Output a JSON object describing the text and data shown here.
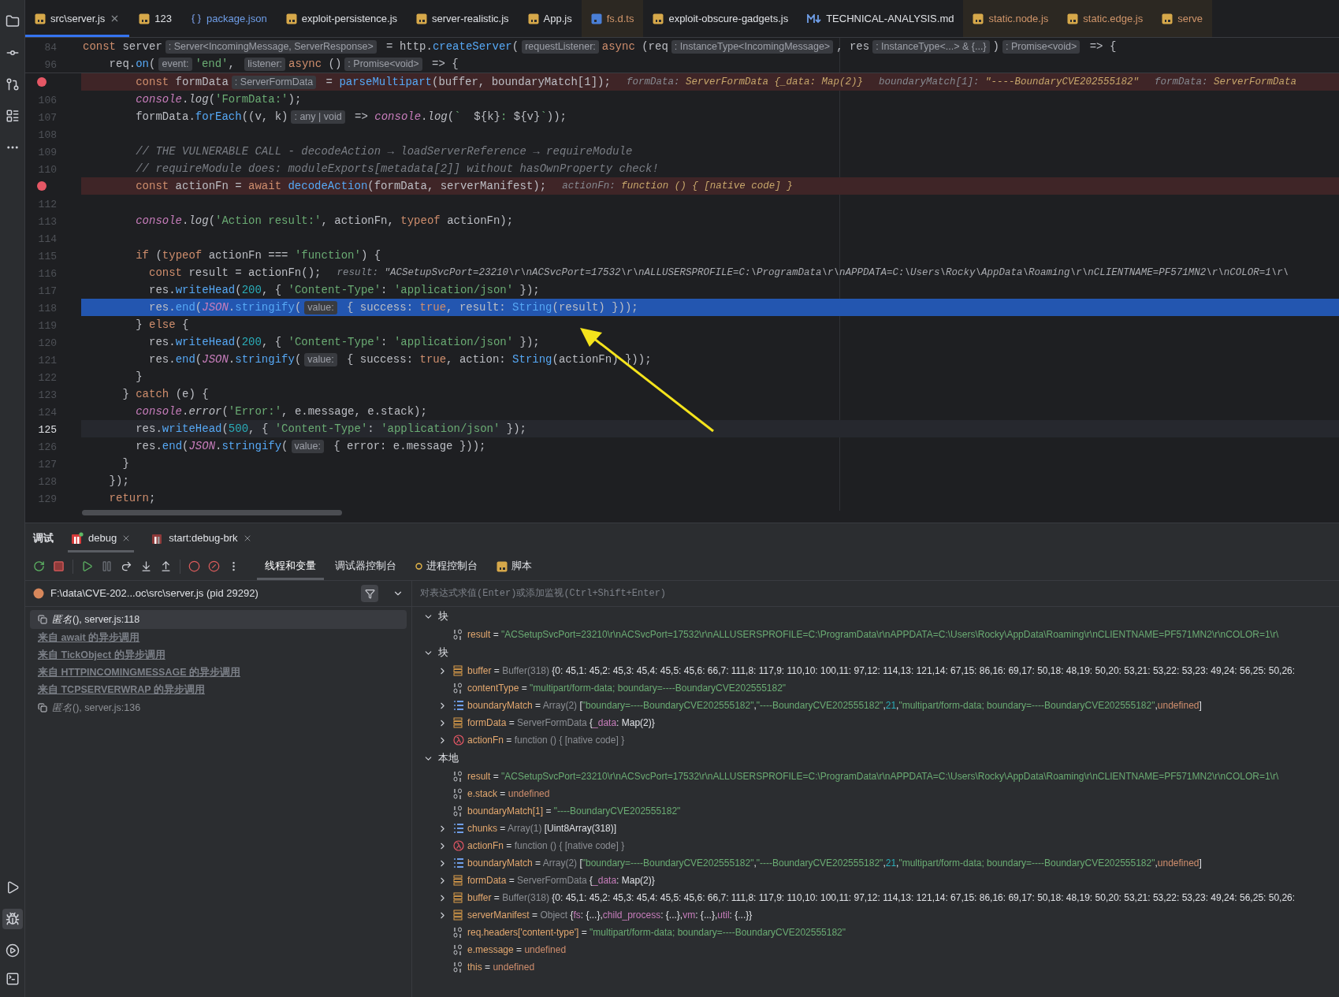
{
  "editor_tabs": [
    {
      "label": "src\\server.js",
      "kind": "js",
      "selected": true,
      "closable": true,
      "color": "#dfe1e5",
      "highlighted": false
    },
    {
      "label": "123",
      "kind": "js",
      "selected": false,
      "closable": false,
      "color": "#dfe1e5",
      "highlighted": false
    },
    {
      "label": "package.json",
      "kind": "json",
      "selected": false,
      "closable": false,
      "color": "#6f9ee8",
      "highlighted": false
    },
    {
      "label": "exploit-persistence.js",
      "kind": "js",
      "selected": false,
      "closable": false,
      "color": "#dfe1e5",
      "highlighted": false
    },
    {
      "label": "server-realistic.js",
      "kind": "js",
      "selected": false,
      "closable": false,
      "color": "#dfe1e5",
      "highlighted": false
    },
    {
      "label": "App.js",
      "kind": "js",
      "selected": false,
      "closable": false,
      "color": "#dfe1e5",
      "highlighted": false
    },
    {
      "label": "fs.d.ts",
      "kind": "ts",
      "selected": false,
      "closable": false,
      "color": "#d0956a",
      "highlighted": true
    },
    {
      "label": "exploit-obscure-gadgets.js",
      "kind": "js",
      "selected": false,
      "closable": false,
      "color": "#dfe1e5",
      "highlighted": false
    },
    {
      "label": "TECHNICAL-ANALYSIS.md",
      "kind": "md",
      "selected": false,
      "closable": false,
      "color": "#dfe1e5",
      "highlighted": false
    },
    {
      "label": "static.node.js",
      "kind": "js",
      "selected": false,
      "closable": false,
      "color": "#d0956a",
      "highlighted": true
    },
    {
      "label": "static.edge.js",
      "kind": "js",
      "selected": false,
      "closable": false,
      "color": "#d0956a",
      "highlighted": true
    },
    {
      "label": "serve",
      "kind": "js",
      "selected": false,
      "closable": false,
      "color": "#d0956a",
      "highlighted": true
    }
  ],
  "sticky_lines": [
    {
      "number": "84",
      "segments": [
        {
          "kind": "k",
          "text": "const"
        },
        {
          "kind": "p",
          "text": " server"
        },
        {
          "kind": "hint",
          "text": ": Server<IncomingMessage, ServerResponse>"
        },
        {
          "kind": "p",
          "text": " = http."
        },
        {
          "kind": "f",
          "text": "createServer"
        },
        {
          "kind": "p",
          "text": "("
        },
        {
          "kind": "hint",
          "text": "requestListener:"
        },
        {
          "kind": "k",
          "text": "async"
        },
        {
          "kind": "p",
          "text": " (req"
        },
        {
          "kind": "hint",
          "text": ": InstanceType<IncomingMessage>"
        },
        {
          "kind": "p",
          "text": ", res"
        },
        {
          "kind": "hint",
          "text": ": InstanceType<...> & {...}"
        },
        {
          "kind": "p",
          "text": ")"
        },
        {
          "kind": "hint",
          "text": ": Promise<void>"
        },
        {
          "kind": "p",
          "text": " => {"
        }
      ]
    },
    {
      "number": "96",
      "segments": [
        {
          "kind": "p",
          "text": "    req."
        },
        {
          "kind": "f",
          "text": "on"
        },
        {
          "kind": "p",
          "text": "("
        },
        {
          "kind": "hint",
          "text": "event:"
        },
        {
          "kind": "s",
          "text": "'end'"
        },
        {
          "kind": "p",
          "text": ", "
        },
        {
          "kind": "hint",
          "text": "listener:"
        },
        {
          "kind": "k",
          "text": "async"
        },
        {
          "kind": "p",
          "text": " ()"
        },
        {
          "kind": "hint",
          "text": ": Promise<void>"
        },
        {
          "kind": "p",
          "text": " => {"
        }
      ]
    }
  ],
  "code_lines": [
    {
      "breakpoint": true,
      "execution_point": false,
      "caret_line": false,
      "segments": [
        {
          "kind": "k",
          "text": "        const"
        },
        {
          "kind": "p",
          "text": " formData"
        },
        {
          "kind": "hint",
          "text": ": ServerFormData"
        },
        {
          "kind": "p",
          "text": " = "
        },
        {
          "kind": "f",
          "text": "parseMultipart"
        },
        {
          "kind": "p",
          "text": "(buffer, boundaryMatch[1]);"
        },
        {
          "kind": "vname",
          "text": "formData: "
        },
        {
          "kind": "val",
          "text": "ServerFormData {_data: Map(2)}"
        },
        {
          "kind": "vname",
          "text": "boundaryMatch[1]: "
        },
        {
          "kind": "val",
          "text": "\"----BoundaryCVE202555182\""
        },
        {
          "kind": "vname",
          "text": "formData: "
        },
        {
          "kind": "val",
          "text": "ServerFormData"
        }
      ]
    },
    {
      "number": "106",
      "breakpoint": false,
      "execution_point": false,
      "caret_line": false,
      "segments": [
        {
          "kind": "ip",
          "text": "        console"
        },
        {
          "kind": "p",
          "text": "."
        },
        {
          "kind": "it",
          "text": "log"
        },
        {
          "kind": "p",
          "text": "("
        },
        {
          "kind": "s",
          "text": "'FormData:'"
        },
        {
          "kind": "p",
          "text": ");"
        }
      ]
    },
    {
      "number": "107",
      "breakpoint": false,
      "execution_point": false,
      "caret_line": false,
      "segments": [
        {
          "kind": "p",
          "text": "        formData."
        },
        {
          "kind": "f",
          "text": "forEach"
        },
        {
          "kind": "p",
          "text": "((v, k)"
        },
        {
          "kind": "hint",
          "text": ": any | void"
        },
        {
          "kind": "p",
          "text": " => "
        },
        {
          "kind": "ip",
          "text": "console"
        },
        {
          "kind": "p",
          "text": "."
        },
        {
          "kind": "it",
          "text": "log"
        },
        {
          "kind": "p",
          "text": "("
        },
        {
          "kind": "s",
          "text": "`  "
        },
        {
          "kind": "p",
          "text": "${k}"
        },
        {
          "kind": "s",
          "text": ": "
        },
        {
          "kind": "p",
          "text": "${v}"
        },
        {
          "kind": "s",
          "text": "`"
        },
        {
          "kind": "p",
          "text": "));"
        }
      ]
    },
    {
      "number": "108",
      "breakpoint": false,
      "execution_point": false,
      "caret_line": false
    },
    {
      "number": "109",
      "breakpoint": false,
      "execution_point": false,
      "caret_line": false,
      "segments": [
        {
          "kind": "c",
          "text": "        // THE VULNERABLE CALL - decodeAction → loadServerReference → requireModule"
        }
      ]
    },
    {
      "number": "110",
      "breakpoint": false,
      "execution_point": false,
      "caret_line": false,
      "segments": [
        {
          "kind": "c",
          "text": "        // requireModule does: moduleExports[metadata[2]] without hasOwnProperty check!"
        }
      ]
    },
    {
      "breakpoint": true,
      "execution_point": false,
      "caret_line": false,
      "segments": [
        {
          "kind": "k",
          "text": "        const"
        },
        {
          "kind": "p",
          "text": " actionFn = "
        },
        {
          "kind": "k",
          "text": "await"
        },
        {
          "kind": "f",
          "text": " decodeAction"
        },
        {
          "kind": "p",
          "text": "(formData, serverManifest);"
        },
        {
          "kind": "vname",
          "text": "actionFn: "
        },
        {
          "kind": "val",
          "text": "function () { [native code] }"
        }
      ]
    },
    {
      "number": "112",
      "breakpoint": false,
      "execution_point": false,
      "caret_line": false
    },
    {
      "number": "113",
      "breakpoint": false,
      "execution_point": false,
      "caret_line": false,
      "segments": [
        {
          "kind": "ip",
          "text": "        console"
        },
        {
          "kind": "p",
          "text": "."
        },
        {
          "kind": "it",
          "text": "log"
        },
        {
          "kind": "p",
          "text": "("
        },
        {
          "kind": "s",
          "text": "'Action result:'"
        },
        {
          "kind": "p",
          "text": ", actionFn, "
        },
        {
          "kind": "k",
          "text": "typeof"
        },
        {
          "kind": "p",
          "text": " actionFn);"
        }
      ]
    },
    {
      "number": "114",
      "breakpoint": false,
      "execution_point": false,
      "caret_line": false
    },
    {
      "number": "115",
      "breakpoint": false,
      "execution_point": false,
      "caret_line": false,
      "segments": [
        {
          "kind": "k",
          "text": "        if"
        },
        {
          "kind": "p",
          "text": " ("
        },
        {
          "kind": "k",
          "text": "typeof"
        },
        {
          "kind": "p",
          "text": " actionFn === "
        },
        {
          "kind": "s",
          "text": "'function'"
        },
        {
          "kind": "p",
          "text": ") {"
        }
      ]
    },
    {
      "number": "116",
      "breakpoint": false,
      "execution_point": false,
      "caret_line": false,
      "segments": [
        {
          "kind": "k",
          "text": "          const"
        },
        {
          "kind": "p",
          "text": " result = actionFn();"
        },
        {
          "kind": "vname",
          "text": "result: "
        },
        {
          "kind": "val2",
          "text": "\"ACSetupSvcPort=23210\\r\\nACSvcPort=17532\\r\\nALLUSERSPROFILE=C:\\ProgramData\\r\\nAPPDATA=C:\\Users\\Rocky\\AppData\\Roaming\\r\\nCLIENTNAME=PF571MN2\\r\\nCOLOR=1\\r\\"
        }
      ]
    },
    {
      "number": "117",
      "breakpoint": false,
      "execution_point": false,
      "caret_line": false,
      "segments": [
        {
          "kind": "p",
          "text": "          res."
        },
        {
          "kind": "f",
          "text": "writeHead"
        },
        {
          "kind": "p",
          "text": "("
        },
        {
          "kind": "n",
          "text": "200"
        },
        {
          "kind": "p",
          "text": ", { "
        },
        {
          "kind": "s",
          "text": "'Content-Type'"
        },
        {
          "kind": "p",
          "text": ": "
        },
        {
          "kind": "s",
          "text": "'application/json'"
        },
        {
          "kind": "p",
          "text": " });"
        }
      ]
    },
    {
      "number": "118",
      "breakpoint": false,
      "execution_point": true,
      "caret_line": false,
      "segments": [
        {
          "kind": "p",
          "text": "          res."
        },
        {
          "kind": "f",
          "text": "end"
        },
        {
          "kind": "p",
          "text": "("
        },
        {
          "kind": "ip",
          "text": "JSON"
        },
        {
          "kind": "p",
          "text": "."
        },
        {
          "kind": "f",
          "text": "stringify"
        },
        {
          "kind": "p",
          "text": "("
        },
        {
          "kind": "hint",
          "text": "value:"
        },
        {
          "kind": "p",
          "text": " { success: "
        },
        {
          "kind": "k",
          "text": "true"
        },
        {
          "kind": "p",
          "text": ", result: "
        },
        {
          "kind": "f",
          "text": "String"
        },
        {
          "kind": "p",
          "text": "(result) }));"
        }
      ]
    },
    {
      "number": "119",
      "breakpoint": false,
      "execution_point": false,
      "caret_line": false,
      "segments": [
        {
          "kind": "p",
          "text": "        } "
        },
        {
          "kind": "k",
          "text": "else"
        },
        {
          "kind": "p",
          "text": " {"
        }
      ]
    },
    {
      "number": "120",
      "breakpoint": false,
      "execution_point": false,
      "caret_line": false,
      "segments": [
        {
          "kind": "p",
          "text": "          res."
        },
        {
          "kind": "f",
          "text": "writeHead"
        },
        {
          "kind": "p",
          "text": "("
        },
        {
          "kind": "n",
          "text": "200"
        },
        {
          "kind": "p",
          "text": ", { "
        },
        {
          "kind": "s",
          "text": "'Content-Type'"
        },
        {
          "kind": "p",
          "text": ": "
        },
        {
          "kind": "s",
          "text": "'application/json'"
        },
        {
          "kind": "p",
          "text": " });"
        }
      ]
    },
    {
      "number": "121",
      "breakpoint": false,
      "execution_point": false,
      "caret_line": false,
      "segments": [
        {
          "kind": "p",
          "text": "          res."
        },
        {
          "kind": "f",
          "text": "end"
        },
        {
          "kind": "p",
          "text": "("
        },
        {
          "kind": "ip",
          "text": "JSON"
        },
        {
          "kind": "p",
          "text": "."
        },
        {
          "kind": "f",
          "text": "stringify"
        },
        {
          "kind": "p",
          "text": "("
        },
        {
          "kind": "hint",
          "text": "value:"
        },
        {
          "kind": "p",
          "text": " { success: "
        },
        {
          "kind": "k",
          "text": "true"
        },
        {
          "kind": "p",
          "text": ", action: "
        },
        {
          "kind": "f",
          "text": "String"
        },
        {
          "kind": "p",
          "text": "(actionFn) }));"
        }
      ]
    },
    {
      "number": "122",
      "breakpoint": false,
      "execution_point": false,
      "caret_line": false,
      "segments": [
        {
          "kind": "p",
          "text": "        }"
        }
      ]
    },
    {
      "number": "123",
      "breakpoint": false,
      "execution_point": false,
      "caret_line": false,
      "segments": [
        {
          "kind": "p",
          "text": "      } "
        },
        {
          "kind": "k",
          "text": "catch"
        },
        {
          "kind": "p",
          "text": " (e) {"
        }
      ]
    },
    {
      "number": "124",
      "breakpoint": false,
      "execution_point": false,
      "caret_line": false,
      "segments": [
        {
          "kind": "ip",
          "text": "        console"
        },
        {
          "kind": "p",
          "text": "."
        },
        {
          "kind": "it",
          "text": "error"
        },
        {
          "kind": "p",
          "text": "("
        },
        {
          "kind": "s",
          "text": "'Error:'"
        },
        {
          "kind": "p",
          "text": ", e.message, e.stack);"
        }
      ]
    },
    {
      "number": "125",
      "breakpoint": false,
      "execution_point": false,
      "caret_line": true,
      "segments": [
        {
          "kind": "p",
          "text": "        res."
        },
        {
          "kind": "f",
          "text": "writeHead"
        },
        {
          "kind": "p",
          "text": "("
        },
        {
          "kind": "n",
          "text": "500"
        },
        {
          "kind": "p",
          "text": ", { "
        },
        {
          "kind": "s",
          "text": "'Content-Type'"
        },
        {
          "kind": "p",
          "text": ": "
        },
        {
          "kind": "s",
          "text": "'application/json'"
        },
        {
          "kind": "p",
          "text": " });"
        }
      ]
    },
    {
      "number": "126",
      "breakpoint": false,
      "execution_point": false,
      "caret_line": false,
      "segments": [
        {
          "kind": "p",
          "text": "        res."
        },
        {
          "kind": "f",
          "text": "end"
        },
        {
          "kind": "p",
          "text": "("
        },
        {
          "kind": "ip",
          "text": "JSON"
        },
        {
          "kind": "p",
          "text": "."
        },
        {
          "kind": "f",
          "text": "stringify"
        },
        {
          "kind": "p",
          "text": "("
        },
        {
          "kind": "hint",
          "text": "value:"
        },
        {
          "kind": "p",
          "text": " { error: e.message }));"
        }
      ]
    },
    {
      "number": "127",
      "breakpoint": false,
      "execution_point": false,
      "caret_line": false,
      "segments": [
        {
          "kind": "p",
          "text": "      }"
        }
      ]
    },
    {
      "number": "128",
      "breakpoint": false,
      "execution_point": false,
      "caret_line": false,
      "segments": [
        {
          "kind": "p",
          "text": "    });"
        }
      ]
    },
    {
      "number": "129",
      "breakpoint": false,
      "execution_point": false,
      "caret_line": false,
      "segments": [
        {
          "kind": "k",
          "text": "    return"
        },
        {
          "kind": "p",
          "text": ";"
        }
      ]
    }
  ],
  "debug_panel": {
    "title": "调试",
    "run_tabs": [
      {
        "label": "debug",
        "selected": true,
        "running": true
      },
      {
        "label": "start:debug-brk",
        "selected": false,
        "running": false
      }
    ],
    "view_tabs": [
      {
        "label": "线程和变量",
        "selected": true,
        "kind": "plain"
      },
      {
        "label": "调试器控制台",
        "selected": false,
        "kind": "plain"
      },
      {
        "label": "进程控制台",
        "selected": false,
        "kind": "process"
      },
      {
        "label": "脚本",
        "selected": false,
        "kind": "js"
      }
    ],
    "process": {
      "label": "F:\\data\\CVE-202...oc\\src\\server.js (pid 29292)"
    },
    "frames": [
      {
        "kind": "frame",
        "label": "*匿名*(), server.js:118",
        "selected": true
      },
      {
        "kind": "async",
        "label": "来自 await 的异步调用",
        "selected": false
      },
      {
        "kind": "async",
        "label": "来自 TickObject 的异步调用",
        "selected": false
      },
      {
        "kind": "async",
        "label": "来自 HTTPINCOMINGMESSAGE 的异步调用",
        "selected": false
      },
      {
        "kind": "async",
        "label": "来自 TCPSERVERWRAP 的异步调用",
        "selected": false
      },
      {
        "kind": "frame",
        "label": "*匿名*(), server.js:136",
        "selected": false
      }
    ],
    "watch": {
      "placeholder": "对表达式求值(Enter)或添加监视(Ctrl+Shift+Enter)"
    },
    "scopes": [
      {
        "label": "块",
        "expanded": true,
        "variables": [
          {
            "name": "result",
            "kind": "primitive",
            "expandable": false,
            "value": [
              {
                "kind": "plain",
                "text": " = "
              },
              {
                "kind": "str",
                "text": "\"ACSetupSvcPort=23210\\r\\nACSvcPort=17532\\r\\nALLUSERSPROFILE=C:\\ProgramData\\r\\nAPPDATA=C:\\Users\\Rocky\\AppData\\Roaming\\r\\nCLIENTNAME=PF571MN2\\r\\nCOLOR=1\\r\\"
              }
            ]
          }
        ]
      },
      {
        "label": "块",
        "expanded": true,
        "variables": [
          {
            "name": "buffer",
            "kind": "object",
            "expandable": true,
            "value": [
              {
                "kind": "plain",
                "text": " = "
              },
              {
                "kind": "type",
                "text": "Buffer(318)"
              },
              {
                "kind": "plain",
                "text": " {0: 45,1: 45,2: 45,3: 45,4: 45,5: 45,6: 66,7: 111,8: 117,9: 110,10: 100,11: 97,12: 114,13: 121,14: 67,15: 86,16: 69,17: 50,18: 48,19: 50,20: 53,21: 53,22: 53,23: 49,24: 56,25: 50,26:"
              }
            ]
          },
          {
            "name": "contentType",
            "kind": "primitive",
            "expandable": false,
            "value": [
              {
                "kind": "plain",
                "text": " = "
              },
              {
                "kind": "str",
                "text": "\"multipart/form-data; boundary=----BoundaryCVE202555182\""
              }
            ]
          },
          {
            "name": "boundaryMatch",
            "kind": "array",
            "expandable": true,
            "value": [
              {
                "kind": "plain",
                "text": " = "
              },
              {
                "kind": "type",
                "text": "Array(2)"
              },
              {
                "kind": "plain",
                "text": " ["
              },
              {
                "kind": "str",
                "text": "\"boundary=----BoundaryCVE202555182\""
              },
              {
                "kind": "plain",
                "text": ","
              },
              {
                "kind": "str",
                "text": "\"----BoundaryCVE202555182\""
              },
              {
                "kind": "plain",
                "text": ","
              },
              {
                "kind": "num",
                "text": "21"
              },
              {
                "kind": "plain",
                "text": ","
              },
              {
                "kind": "str",
                "text": "\"multipart/form-data; boundary=----BoundaryCVE202555182\""
              },
              {
                "kind": "plain",
                "text": ","
              },
              {
                "kind": "undef",
                "text": "undefined"
              },
              {
                "kind": "plain",
                "text": "]"
              }
            ]
          },
          {
            "name": "formData",
            "kind": "object",
            "expandable": true,
            "value": [
              {
                "kind": "plain",
                "text": " = "
              },
              {
                "kind": "type",
                "text": "ServerFormData"
              },
              {
                "kind": "plain",
                "text": " {"
              },
              {
                "kind": "key",
                "text": "_data"
              },
              {
                "kind": "plain",
                "text": ": Map(2)}"
              }
            ]
          },
          {
            "name": "actionFn",
            "kind": "function",
            "expandable": true,
            "value": [
              {
                "kind": "plain",
                "text": " = "
              },
              {
                "kind": "type",
                "text": "function () { [native code] }"
              }
            ]
          }
        ]
      },
      {
        "label": "本地",
        "expanded": true,
        "variables": [
          {
            "name": "result",
            "kind": "primitive",
            "expandable": false,
            "value": [
              {
                "kind": "plain",
                "text": " = "
              },
              {
                "kind": "str",
                "text": "\"ACSetupSvcPort=23210\\r\\nACSvcPort=17532\\r\\nALLUSERSPROFILE=C:\\ProgramData\\r\\nAPPDATA=C:\\Users\\Rocky\\AppData\\Roaming\\r\\nCLIENTNAME=PF571MN2\\r\\nCOLOR=1\\r\\"
              }
            ]
          },
          {
            "name": "e.stack",
            "kind": "primitive",
            "expandable": false,
            "value": [
              {
                "kind": "plain",
                "text": " = "
              },
              {
                "kind": "undef",
                "text": "undefined"
              }
            ]
          },
          {
            "name": "boundaryMatch[1]",
            "kind": "primitive",
            "expandable": false,
            "value": [
              {
                "kind": "plain",
                "text": " = "
              },
              {
                "kind": "str",
                "text": "\"----BoundaryCVE202555182\""
              }
            ]
          },
          {
            "name": "chunks",
            "kind": "array",
            "expandable": true,
            "value": [
              {
                "kind": "plain",
                "text": " = "
              },
              {
                "kind": "type",
                "text": "Array(1)"
              },
              {
                "kind": "plain",
                "text": " [Uint8Array(318)]"
              }
            ]
          },
          {
            "name": "actionFn",
            "kind": "function",
            "expandable": true,
            "value": [
              {
                "kind": "plain",
                "text": " = "
              },
              {
                "kind": "type",
                "text": "function () { [native code] }"
              }
            ]
          },
          {
            "name": "boundaryMatch",
            "kind": "array",
            "expandable": true,
            "value": [
              {
                "kind": "plain",
                "text": " = "
              },
              {
                "kind": "type",
                "text": "Array(2)"
              },
              {
                "kind": "plain",
                "text": " ["
              },
              {
                "kind": "str",
                "text": "\"boundary=----BoundaryCVE202555182\""
              },
              {
                "kind": "plain",
                "text": ","
              },
              {
                "kind": "str",
                "text": "\"----BoundaryCVE202555182\""
              },
              {
                "kind": "plain",
                "text": ","
              },
              {
                "kind": "num",
                "text": "21"
              },
              {
                "kind": "plain",
                "text": ","
              },
              {
                "kind": "str",
                "text": "\"multipart/form-data; boundary=----BoundaryCVE202555182\""
              },
              {
                "kind": "plain",
                "text": ","
              },
              {
                "kind": "undef",
                "text": "undefined"
              },
              {
                "kind": "plain",
                "text": "]"
              }
            ]
          },
          {
            "name": "formData",
            "kind": "object",
            "expandable": true,
            "value": [
              {
                "kind": "plain",
                "text": " = "
              },
              {
                "kind": "type",
                "text": "ServerFormData"
              },
              {
                "kind": "plain",
                "text": " {"
              },
              {
                "kind": "key",
                "text": "_data"
              },
              {
                "kind": "plain",
                "text": ": Map(2)}"
              }
            ]
          },
          {
            "name": "buffer",
            "kind": "object",
            "expandable": true,
            "value": [
              {
                "kind": "plain",
                "text": " = "
              },
              {
                "kind": "type",
                "text": "Buffer(318)"
              },
              {
                "kind": "plain",
                "text": " {0: 45,1: 45,2: 45,3: 45,4: 45,5: 45,6: 66,7: 111,8: 117,9: 110,10: 100,11: 97,12: 114,13: 121,14: 67,15: 86,16: 69,17: 50,18: 48,19: 50,20: 53,21: 53,22: 53,23: 49,24: 56,25: 50,26:"
              }
            ]
          },
          {
            "name": "serverManifest",
            "kind": "object",
            "expandable": true,
            "value": [
              {
                "kind": "plain",
                "text": " = "
              },
              {
                "kind": "type",
                "text": "Object"
              },
              {
                "kind": "plain",
                "text": " {"
              },
              {
                "kind": "key",
                "text": "fs"
              },
              {
                "kind": "plain",
                "text": ": {...},"
              },
              {
                "kind": "key",
                "text": "child_process"
              },
              {
                "kind": "plain",
                "text": ": {...},"
              },
              {
                "kind": "key",
                "text": "vm"
              },
              {
                "kind": "plain",
                "text": ": {...},"
              },
              {
                "kind": "key",
                "text": "util"
              },
              {
                "kind": "plain",
                "text": ": {...}}"
              }
            ]
          },
          {
            "name": "req.headers['content-type']",
            "kind": "primitive",
            "expandable": false,
            "value": [
              {
                "kind": "plain",
                "text": " = "
              },
              {
                "kind": "str",
                "text": "\"multipart/form-data; boundary=----BoundaryCVE202555182\""
              }
            ]
          },
          {
            "name": "e.message",
            "kind": "primitive",
            "expandable": false,
            "value": [
              {
                "kind": "plain",
                "text": " = "
              },
              {
                "kind": "undef",
                "text": "undefined"
              }
            ]
          },
          {
            "name": "this",
            "kind": "primitive",
            "expandable": false,
            "value": [
              {
                "kind": "plain",
                "text": " = "
              },
              {
                "kind": "undef",
                "text": "undefined"
              }
            ]
          }
        ]
      }
    ]
  }
}
